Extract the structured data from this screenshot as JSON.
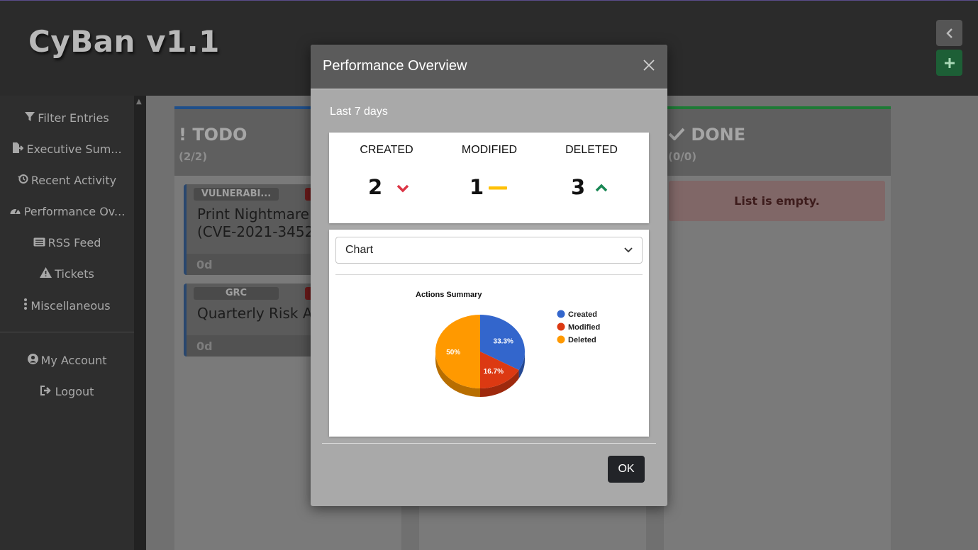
{
  "app": {
    "title": "CyBan v1.1",
    "collapse_icon": "chevron-left-icon",
    "add_icon": "plus-icon"
  },
  "sidebar": {
    "items": [
      {
        "label": "Filter Entries",
        "icon": "filter-icon"
      },
      {
        "label": "Executive Sum...",
        "icon": "export-file-icon"
      },
      {
        "label": "Recent Activity",
        "icon": "history-icon"
      },
      {
        "label": "Performance Ov...",
        "icon": "gauge-icon"
      },
      {
        "label": "RSS Feed",
        "icon": "newspaper-icon"
      },
      {
        "label": "Tickets",
        "icon": "warning-icon"
      },
      {
        "label": "Miscellaneous",
        "icon": "ellipsis-vertical-icon"
      }
    ],
    "account": [
      {
        "label": "My Account",
        "icon": "user-circle-icon"
      },
      {
        "label": "Logout",
        "icon": "sign-out-icon"
      }
    ]
  },
  "board": {
    "columns": [
      {
        "title": "TODO",
        "icon": "exclamation-icon",
        "count": "(2/2)",
        "accent": "#1f5fa8",
        "cards": [
          {
            "tag": "VULNERABI...",
            "title_line1": "Print Nightmare",
            "title_line2": "(CVE-2021-34527",
            "age": "0d"
          },
          {
            "tag": "GRC",
            "title_line1": "Quarterly Risk A",
            "title_line2": "",
            "age": "0d"
          }
        ]
      },
      {
        "title": "DONE",
        "icon": "check-icon",
        "count": "(0/0)",
        "accent": "#1e8c3a",
        "empty_text": "List is empty."
      }
    ]
  },
  "modal": {
    "title": "Performance Overview",
    "close_icon": "close-icon",
    "period": "Last 7 days",
    "stats": [
      {
        "label": "CREATED",
        "value": "2",
        "trend_icon": "chevron-down-icon",
        "trend_color": "#dc3545"
      },
      {
        "label": "MODIFIED",
        "value": "1",
        "trend_icon": "dash-icon",
        "trend_color": "#ffc107"
      },
      {
        "label": "DELETED",
        "value": "3",
        "trend_icon": "chevron-up-icon",
        "trend_color": "#198754"
      }
    ],
    "view_select": {
      "selected": "Chart"
    },
    "ok_label": "OK"
  },
  "chart_data": {
    "type": "pie",
    "title": "Actions Summary",
    "categories": [
      "Created",
      "Modified",
      "Deleted"
    ],
    "values": [
      2,
      1,
      3
    ],
    "percent_labels": [
      "33.3%",
      "16.7%",
      "50%"
    ],
    "colors": [
      "#3366cc",
      "#dc3912",
      "#ff9900"
    ],
    "legend_position": "right",
    "style": "3d"
  }
}
